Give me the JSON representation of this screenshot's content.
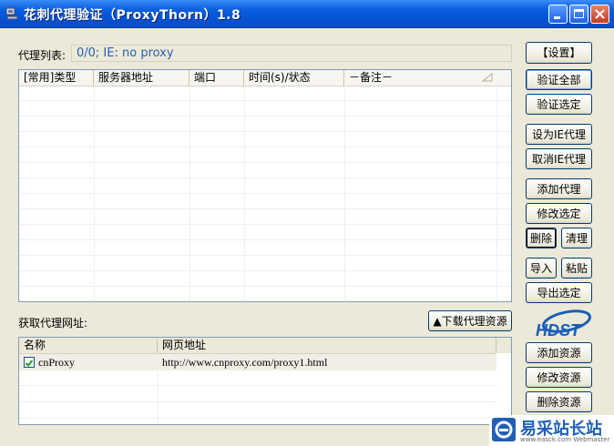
{
  "window": {
    "title": "花刺代理验证（ProxyThorn）1.8"
  },
  "proxy_list": {
    "label": "代理列表:",
    "status": "0/0;   IE: no proxy",
    "columns": [
      "[常用]类型",
      "服务器地址",
      "端口",
      "时间(s)/状态",
      "－备注－"
    ]
  },
  "resource": {
    "label": "获取代理网址:",
    "download_button": "▲下载代理资源",
    "columns": [
      "名称",
      "网页地址"
    ],
    "rows": [
      {
        "name": "cnProxy",
        "url": "http://www.cnproxy.com/proxy1.html",
        "checked": true
      }
    ]
  },
  "buttons": {
    "settings": "【设置】",
    "verify_all": "验证全部",
    "verify_selected": "验证选定",
    "set_ie_proxy": "设为IE代理",
    "cancel_ie_proxy": "取消IE代理",
    "add_proxy": "添加代理",
    "edit_selected": "修改选定",
    "delete": "删除",
    "clear": "清理",
    "import": "导入",
    "paste": "粘贴",
    "export_selected": "导出选定",
    "add_resource": "添加资源",
    "edit_resource": "修改资源",
    "delete_resource": "删除资源"
  },
  "logo": {
    "text": "HDST"
  },
  "watermark": {
    "brand": "易采站长站",
    "sub": "www.easck.com Webmaster"
  },
  "colors": {
    "titlebar": "#0652d4",
    "status_text": "#1f5fb7",
    "logo_blue": "#1b5fb6"
  }
}
